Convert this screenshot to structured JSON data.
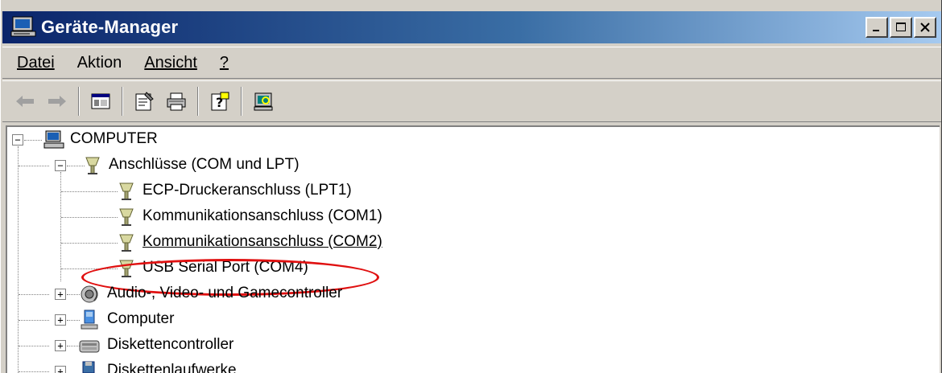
{
  "window": {
    "title": "Geräte-Manager"
  },
  "menu": {
    "items": [
      {
        "label": "Datei"
      },
      {
        "label": "Aktion"
      },
      {
        "label": "Ansicht"
      },
      {
        "label": "?"
      }
    ]
  },
  "toolbar": {
    "buttons": [
      "back-icon",
      "forward-icon",
      "show-hide-tree-icon",
      "properties-icon",
      "print-icon",
      "help-icon",
      "scan-hardware-icon"
    ]
  },
  "tree": {
    "root": {
      "label": "COMPUTER",
      "expanded": true
    },
    "nodes": [
      {
        "label": "Anschlüsse (COM und LPT)",
        "expanded": true
      },
      {
        "label": "ECP-Druckeranschluss (LPT1)"
      },
      {
        "label": "Kommunikationsanschluss (COM1)"
      },
      {
        "label": "Kommunikationsanschluss (COM2)"
      },
      {
        "label": "USB Serial Port (COM4)",
        "highlighted": true
      },
      {
        "label": "Audio-, Video- und Gamecontroller",
        "expanded": false
      },
      {
        "label": "Computer",
        "expanded": false
      },
      {
        "label": "Diskettencontroller",
        "expanded": false
      },
      {
        "label": "Diskettenlaufwerke",
        "expanded": false
      }
    ]
  },
  "colors": {
    "titlebar_start": "#0a246a",
    "titlebar_end": "#a6caf0",
    "chrome": "#d4d0c8",
    "highlight_oval": "#e01010"
  }
}
